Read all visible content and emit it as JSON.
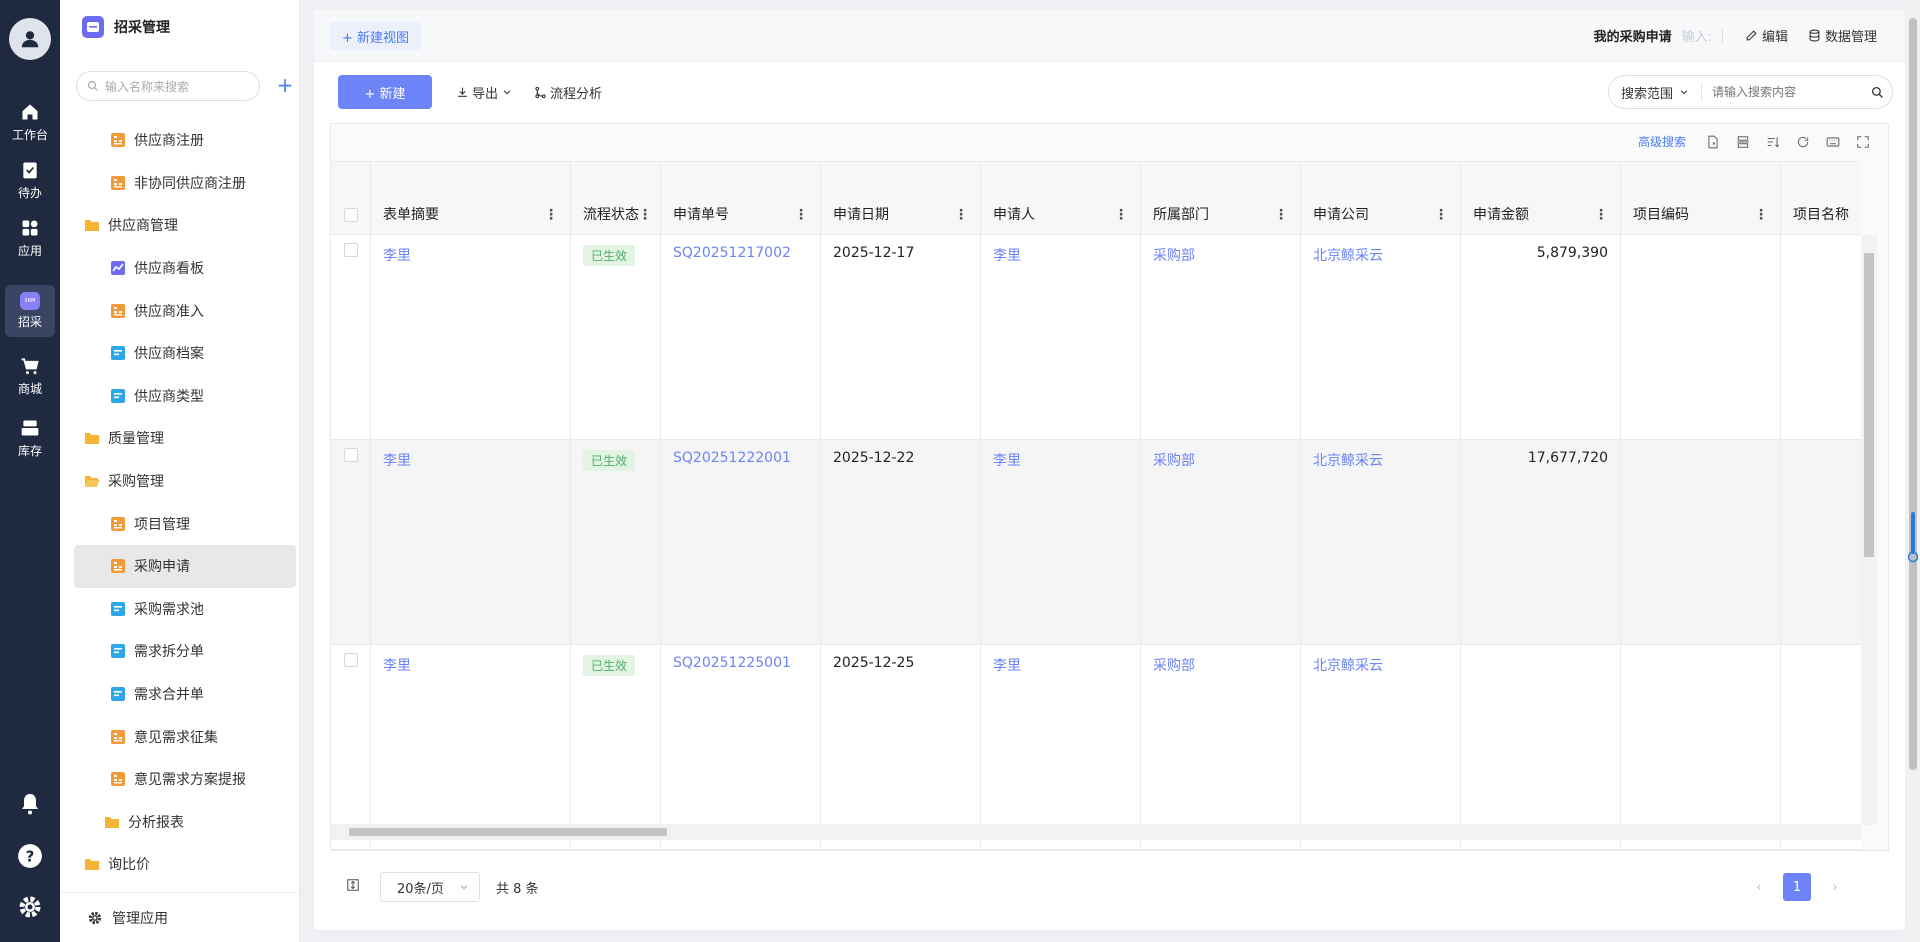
{
  "rail": {
    "items": [
      {
        "label": "工作台",
        "icon": "home-icon"
      },
      {
        "label": "待办",
        "icon": "clipboard-check-icon"
      },
      {
        "label": "应用",
        "icon": "apps-grid-icon"
      },
      {
        "label": "招采",
        "icon": "srm-icon",
        "active": true
      },
      {
        "label": "商城",
        "icon": "cart-icon"
      },
      {
        "label": "库存",
        "icon": "warehouse-icon"
      }
    ],
    "srm_badge": "SRM"
  },
  "sidebar": {
    "title": "招采管理",
    "search_placeholder": "输入名称来搜索",
    "add": "+",
    "items": [
      {
        "label": "供应商注册",
        "icon": "form-orange-icon"
      },
      {
        "label": "非协同供应商注册",
        "icon": "form-orange-icon"
      },
      {
        "label": "供应商管理",
        "icon": "folder-icon"
      },
      {
        "label": "供应商看板",
        "icon": "chart-icon"
      },
      {
        "label": "供应商准入",
        "icon": "form-orange-icon"
      },
      {
        "label": "供应商档案",
        "icon": "doc-blue-icon"
      },
      {
        "label": "供应商类型",
        "icon": "doc-blue-icon"
      },
      {
        "label": "质量管理",
        "icon": "folder-icon"
      },
      {
        "label": "采购管理",
        "icon": "folder-open-icon"
      },
      {
        "label": "项目管理",
        "icon": "form-orange-icon"
      },
      {
        "label": "采购申请",
        "icon": "form-orange-icon",
        "selected": true
      },
      {
        "label": "采购需求池",
        "icon": "doc-blue-icon"
      },
      {
        "label": "需求拆分单",
        "icon": "doc-blue-icon"
      },
      {
        "label": "需求合并单",
        "icon": "doc-blue-icon"
      },
      {
        "label": "意见需求征集",
        "icon": "form-orange-icon"
      },
      {
        "label": "意见需求方案提报",
        "icon": "form-orange-icon"
      },
      {
        "label": "分析报表",
        "icon": "folder-icon"
      },
      {
        "label": "询比价",
        "icon": "folder-icon"
      }
    ],
    "footer": "管理应用"
  },
  "topbar": {
    "new_view": "+ 新建视图",
    "page_title": "我的采购申请",
    "hint": "输入:",
    "edit": "编辑",
    "data_manage": "数据管理"
  },
  "toolbar": {
    "new": "+ 新建",
    "export": "导出",
    "flow_analysis": "流程分析",
    "search_scope": "搜索范围",
    "search_placeholder": "请输入搜索内容"
  },
  "table": {
    "advanced_search": "高级搜索",
    "columns": [
      "表单摘要",
      "流程状态",
      "申请单号",
      "申请日期",
      "申请人",
      "所属部门",
      "申请公司",
      "申请金额",
      "项目编码",
      "项目名称"
    ],
    "rows": [
      {
        "summary": "李里",
        "status": "已生效",
        "no": "SQ20251217002",
        "date": "2025-12-17",
        "applicant": "李里",
        "dept": "采购部",
        "company": "北京鲸采云",
        "amount": "5,879,390",
        "code": "",
        "name": ""
      },
      {
        "summary": "李里",
        "status": "已生效",
        "no": "SQ20251222001",
        "date": "2025-12-22",
        "applicant": "李里",
        "dept": "采购部",
        "company": "北京鲸采云",
        "amount": "17,677,720",
        "code": "",
        "name": ""
      },
      {
        "summary": "李里",
        "status": "已生效",
        "no": "SQ20251225001",
        "date": "2025-12-25",
        "applicant": "李里",
        "dept": "采购部",
        "company": "北京鲸采云",
        "amount": "",
        "code": "",
        "name": ""
      }
    ]
  },
  "pager": {
    "page_size": "20条/页",
    "total": "共 8 条",
    "current_page": "1"
  },
  "colors": {
    "rail_bg": "#1f2940",
    "accent": "#6c84f7",
    "link": "#4a7cf6",
    "badge_bg": "#e3f4e5",
    "badge_text": "#4caf6a"
  }
}
